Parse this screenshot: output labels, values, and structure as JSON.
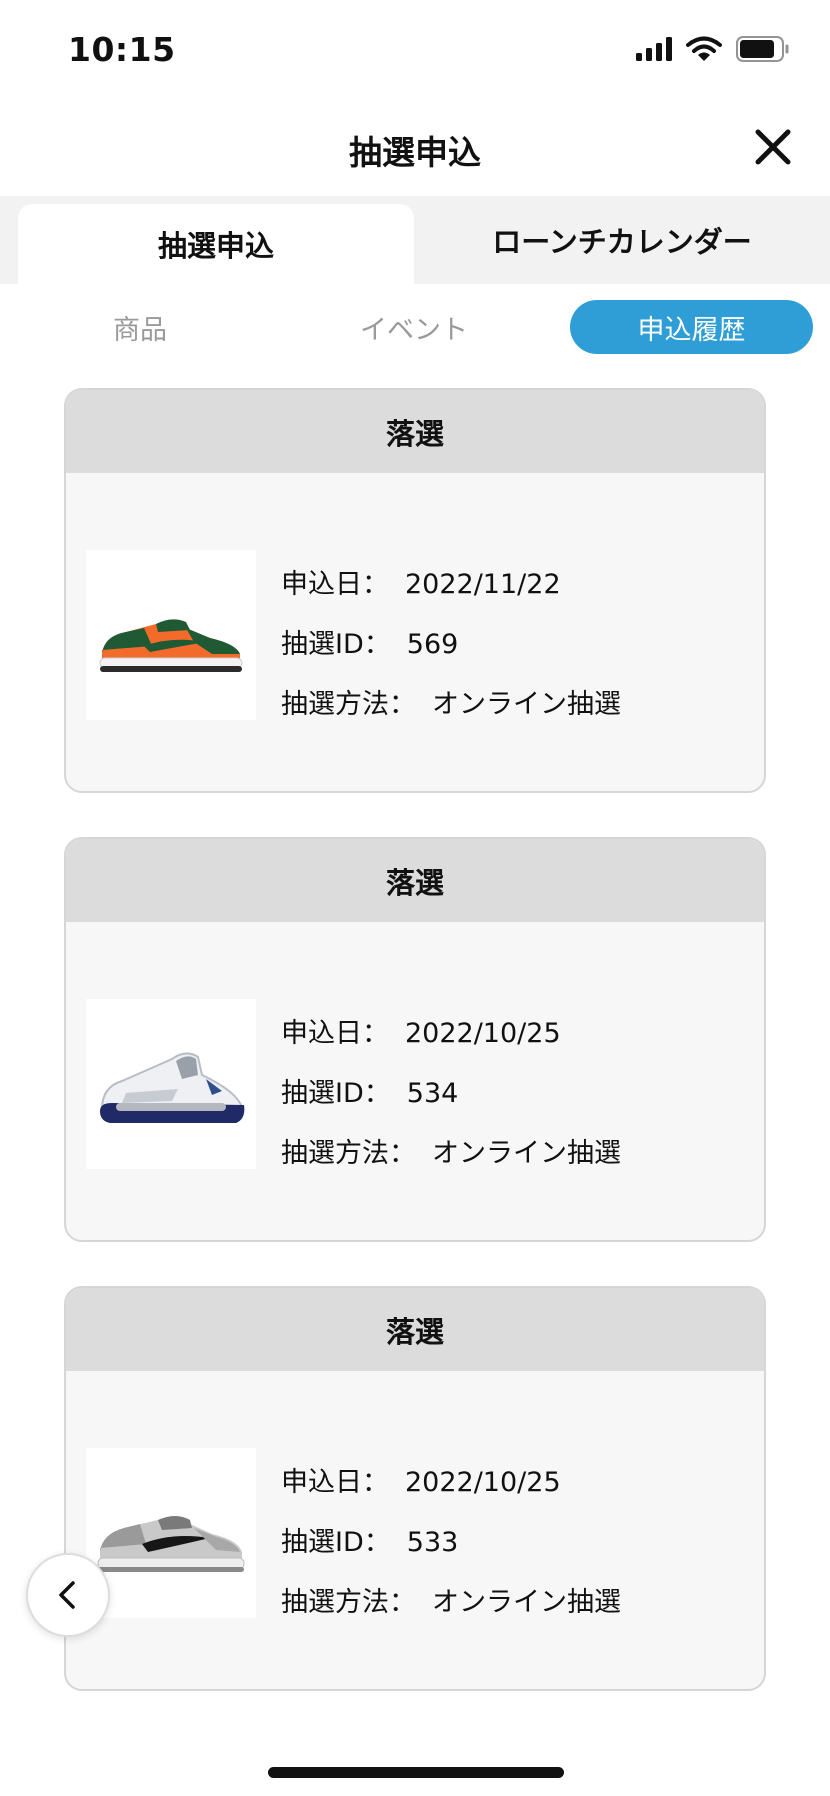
{
  "status_bar": {
    "time": "10:15",
    "icons": [
      "signal-icon",
      "wifi-icon",
      "battery-icon"
    ]
  },
  "header": {
    "title": "抽選申込",
    "close_icon": "close-icon"
  },
  "tabs": [
    {
      "label": "抽選申込",
      "active": true
    },
    {
      "label": "ローンチカレンダー",
      "active": false
    }
  ],
  "subtabs": [
    {
      "label": "商品",
      "active": false
    },
    {
      "label": "イベント",
      "active": false
    },
    {
      "label": "申込履歴",
      "active": true
    }
  ],
  "accent_color": "#2f9ed6",
  "entry_labels": {
    "date": "申込日：",
    "id": "抽選ID：",
    "method": "抽選方法："
  },
  "entries": [
    {
      "status": "落選",
      "date": "2022/11/22",
      "id": "569",
      "method": "オンライン抽選",
      "image": "sneaker-orange-green-icon"
    },
    {
      "status": "落選",
      "date": "2022/10/25",
      "id": "534",
      "method": "オンライン抽選",
      "image": "sneaker-white-navy-icon"
    },
    {
      "status": "落選",
      "date": "2022/10/25",
      "id": "533",
      "method": "オンライン抽選",
      "image": "sneaker-grey-black-icon"
    }
  ],
  "back_icon": "chevron-left-icon"
}
